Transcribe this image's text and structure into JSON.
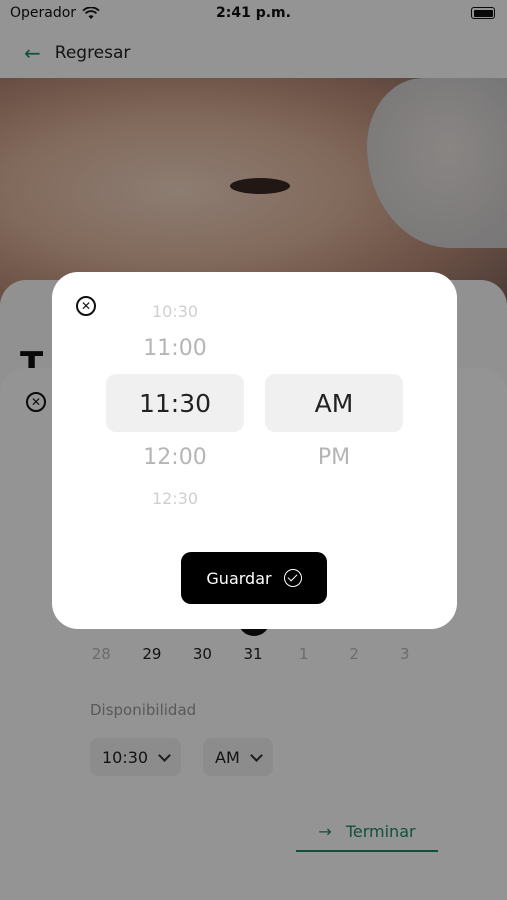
{
  "status_bar": {
    "carrier": "Operador",
    "time": "2:41 p.m."
  },
  "nav": {
    "back_label": "Regresar"
  },
  "hero": {
    "title": "T"
  },
  "calendar": {
    "days": [
      {
        "label": "28",
        "muted": true
      },
      {
        "label": "29",
        "muted": false
      },
      {
        "label": "30",
        "muted": false
      },
      {
        "label": "31",
        "muted": false
      },
      {
        "label": "1",
        "muted": true
      },
      {
        "label": "2",
        "muted": true
      },
      {
        "label": "3",
        "muted": true
      }
    ]
  },
  "availability": {
    "label": "Disponibilidad",
    "time_value": "10:30",
    "ampm_value": "AM"
  },
  "finish_label": "Terminar",
  "picker": {
    "times": [
      "10:30",
      "11:00",
      "11:30",
      "12:00",
      "12:30"
    ],
    "selected_time": "11:30",
    "ampm": [
      "AM",
      "PM"
    ],
    "selected_ampm": "AM",
    "save_label": "Guardar"
  },
  "icons": {
    "close": "close-circle-icon",
    "back": "arrow-left-icon",
    "check": "check-circle-icon",
    "chevron": "chevron-down-icon"
  },
  "colors": {
    "accent": "#1f8a68",
    "button": "#000000",
    "scrim": "rgba(0,0,0,0.42)"
  }
}
